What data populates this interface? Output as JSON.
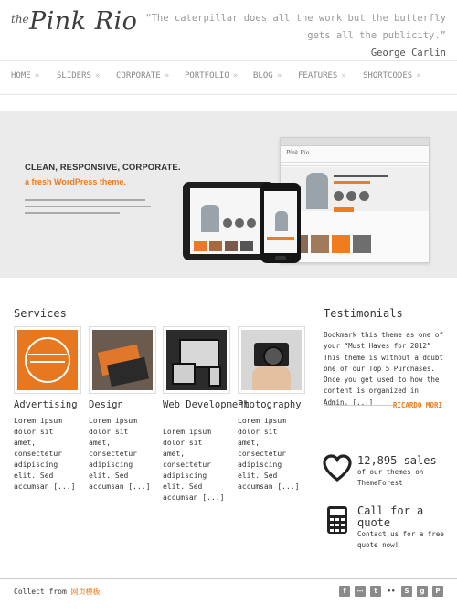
{
  "header": {
    "logo_prefix": "the",
    "logo_name": "Pink Rio",
    "quote_line1": "“The caterpillar does all the work but the butterfly",
    "quote_line2": "gets all the publicity.”",
    "quote_author": "George Carlin"
  },
  "nav": {
    "arrow": "»",
    "items": [
      {
        "label": "HOME"
      },
      {
        "label": "SLIDERS"
      },
      {
        "label": "CORPORATE"
      },
      {
        "label": "PORTFOLIO"
      },
      {
        "label": "BLOG"
      },
      {
        "label": "FEATURES"
      },
      {
        "label": "SHORTCODES"
      }
    ]
  },
  "hero": {
    "headline": "CLEAN, RESPONSIVE, CORPORATE.",
    "subheadline": "a fresh WordPress theme."
  },
  "services": {
    "title": "Services",
    "items": [
      {
        "title": "Advertising",
        "desc": "Lorem ipsum dolor sit amet, consectetur adipiscing elit. Sed accumsan [...]"
      },
      {
        "title": "Design",
        "desc": "Lorem ipsum dolor sit amet, consectetur adipiscing elit. Sed accumsan [...]"
      },
      {
        "title": "Web Development",
        "desc": "Lorem ipsum dolor sit amet, consectetur adipiscing elit. Sed accumsan [...]"
      },
      {
        "title": "Photography",
        "desc": "Lorem ipsum dolor sit amet, consectetur adipiscing elit. Sed accumsan [...]"
      }
    ]
  },
  "testimonials": {
    "title": "Testimonials",
    "text": "Bookmark this theme as one of your “Must Haves for 2012” This theme is without a doubt one of our Top 5 Purchases. Once you get used to how the content is organized in Admin, [...]",
    "author": "RICARDO MORI"
  },
  "stats": {
    "sales_big": "12,895 sales",
    "sales_small": "of our themes on ThemeForest",
    "call_big": "Call for a quote",
    "call_small": "Contact us for a free quote now!"
  },
  "footer": {
    "prefix": "Collect from",
    "link": "网页模板",
    "social_icons": [
      "facebook-icon",
      "rss-icon",
      "twitter-icon",
      "flickr-icon",
      "skype-icon",
      "google-plus-icon",
      "pinterest-icon"
    ]
  },
  "colors": {
    "accent": "#f07c1d",
    "text": "#333333",
    "muted": "#999999",
    "hero_bg": "#ebebeb"
  }
}
